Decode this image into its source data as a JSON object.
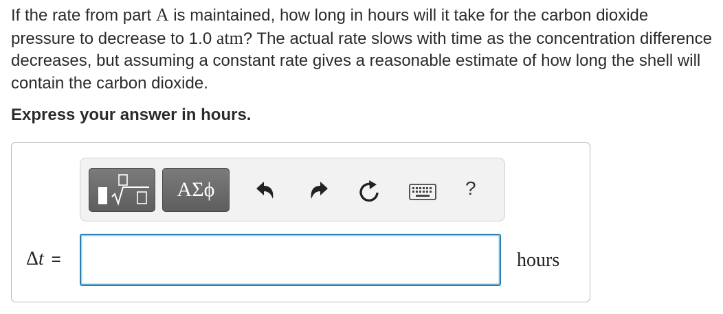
{
  "question": {
    "part1": "If the rate from part ",
    "part_ref": "A",
    "part2": " is maintained, how long in hours will it take for the carbon dioxide pressure to decrease to 1.0 ",
    "unit_atm": "atm",
    "part3": "? The actual rate slows with time as the concentration difference decreases, but assuming a constant rate gives a reasonable estimate of how long the shell will contain the carbon dioxide."
  },
  "instruction": "Express your answer in hours.",
  "toolbar": {
    "templates_icon": "fraction-sqrt-template-icon",
    "symbols_label": "ΑΣϕ",
    "undo_icon": "undo-arrow-icon",
    "redo_icon": "redo-arrow-icon",
    "reset_icon": "reset-circular-arrow-icon",
    "keyboard_icon": "keyboard-icon",
    "help_label": "?"
  },
  "answer": {
    "var_symbol": "Δ",
    "var_letter": "t",
    "equals": "=",
    "input_value": "",
    "unit": "hours"
  },
  "colors": {
    "input_border": "#2a7fae",
    "toolbar_button": "#6b6b6b",
    "toolbar_bg": "#f2f2f2"
  }
}
